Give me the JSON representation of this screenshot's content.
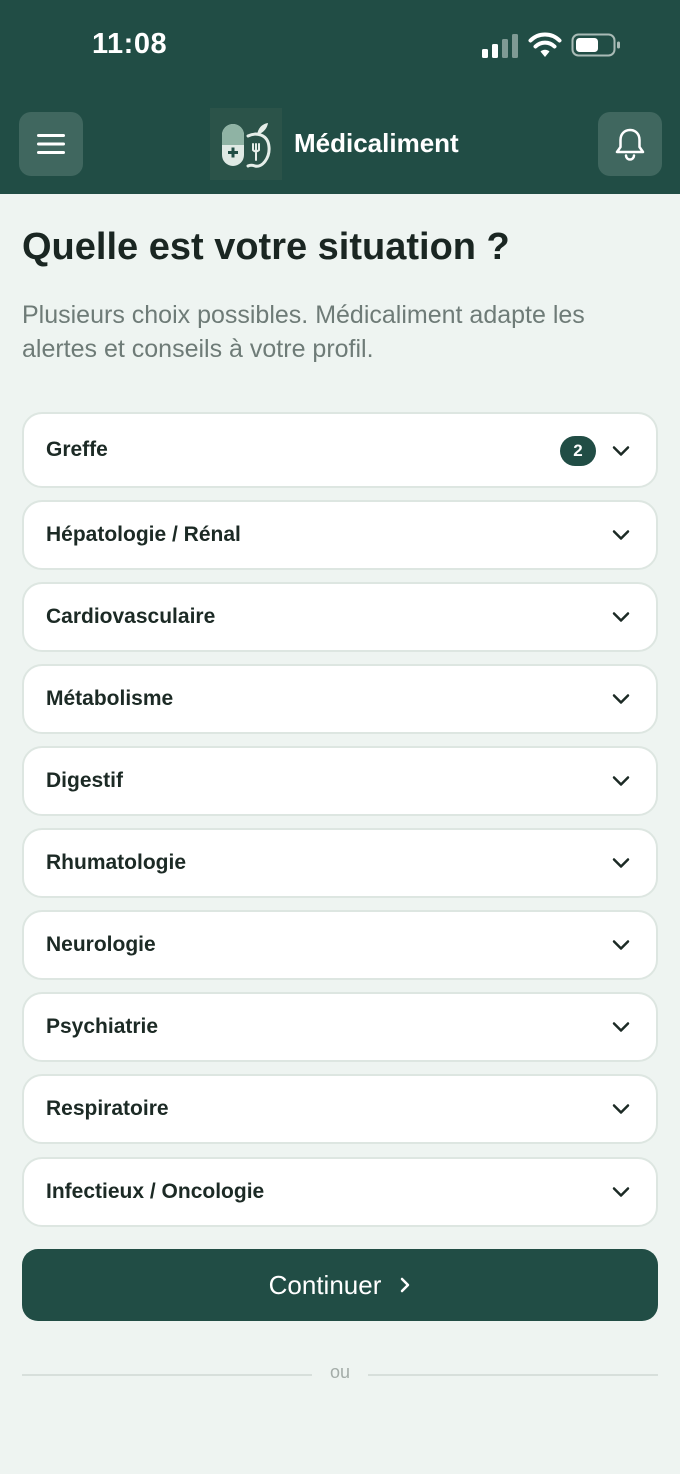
{
  "status_bar": {
    "time": "11:08"
  },
  "header": {
    "app_name": "Médicaliment",
    "menu_icon": "hamburger-menu-icon",
    "notification_icon": "bell-icon",
    "logo_icon": "pill-apple-logo"
  },
  "main": {
    "title": "Quelle est votre situation ?",
    "subtitle": "Plusieurs choix possibles. Médicaliment adapte les alertes et conseils à votre profil.",
    "categories": [
      {
        "label": "Greffe",
        "badge": "2"
      },
      {
        "label": "Hépatologie / Rénal"
      },
      {
        "label": "Cardiovasculaire"
      },
      {
        "label": "Métabolisme"
      },
      {
        "label": "Digestif"
      },
      {
        "label": "Rhumatologie"
      },
      {
        "label": "Neurologie"
      },
      {
        "label": "Psychiatrie"
      },
      {
        "label": "Respiratoire"
      },
      {
        "label": "Infectieux / Oncologie"
      }
    ],
    "continue_label": "Continuer",
    "divider_text": "ou"
  },
  "colors": {
    "primary": "#214d45",
    "background": "#eef4f1",
    "card": "#ffffff",
    "text": "#1c2a25",
    "muted": "#6e7b77"
  }
}
